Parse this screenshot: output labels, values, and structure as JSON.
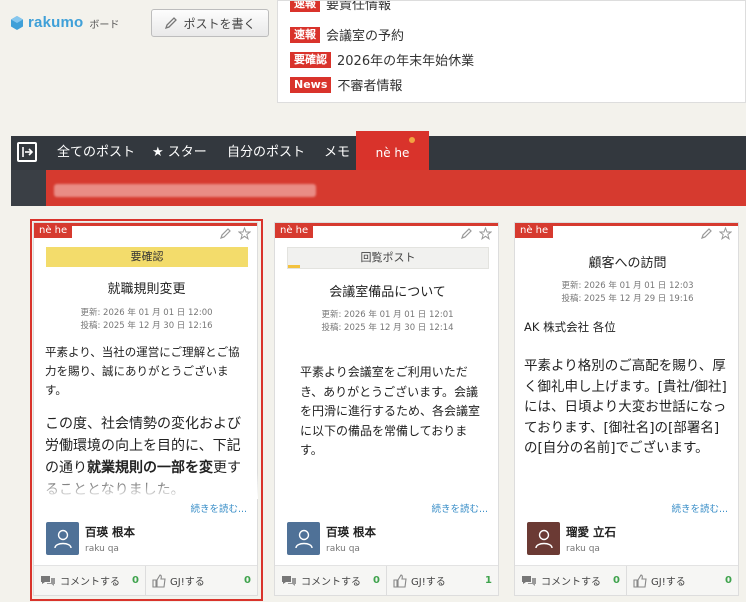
{
  "app": {
    "logo_text": "rakumo",
    "logo_sub": "ボード",
    "write_button": "ポストを書く"
  },
  "news": [
    {
      "badge": "速報",
      "text": "要責任情報"
    },
    {
      "badge": "速報",
      "text": "会議室の予約"
    },
    {
      "badge": "要確認",
      "text": "2026年の年末年始休業"
    },
    {
      "badge": "News",
      "text": "不審者情報"
    }
  ],
  "nav": {
    "items": [
      "全てのポスト",
      "★ スター",
      "自分のポスト",
      "メモ"
    ],
    "active": "nè he"
  },
  "cards": [
    {
      "tag": "nè he",
      "status": "要確認",
      "title": "就職規則変更",
      "updated": "更新: 2026 年 01 月 01 日 12:00",
      "posted": "投稿: 2025 年 12 月 30 日 12:16",
      "body_small": "平素より、当社の運営にご理解とご協力を賜り、誠にありがとうございます。",
      "body_large_1": "この度、社会情勢の変化および労働環境の向上を目的に、下記の通り",
      "body_large_bold": "就業規則の一部を変",
      "body_large_2": "更することとなりました。",
      "read_more": "続きを読む...",
      "author": "百瑛 根本",
      "author_sub": "raku qa",
      "comment_label": "コメントする",
      "comment_count": "0",
      "like_label": "GJ!する",
      "like_count": "0"
    },
    {
      "tag": "nè he",
      "status": "回覧ポスト",
      "title": "会議室備品について",
      "updated": "更新: 2026 年 01 月 01 日 12:01",
      "posted": "投稿: 2025 年 12 月 30 日 12:14",
      "body": "平素より会議室をご利用いただき、ありがとうございます。会議を円滑に進行するため、各会議室に以下の備品を常備しております。",
      "read_more": "続きを読む...",
      "author": "百瑛 根本",
      "author_sub": "raku qa",
      "comment_label": "コメントする",
      "comment_count": "0",
      "like_label": "GJ!する",
      "like_count": "1"
    },
    {
      "tag": "nè he",
      "title": "顧客への訪問",
      "updated": "更新: 2026 年 01 月 01 日 12:03",
      "posted": "投稿: 2025 年 12 月 29 日 19:16",
      "addressee": "AK 株式会社 各位",
      "body": "平素より格別のご高配を賜り、厚く御礼申し上げます。[貴社/御社]には、日頃より大変お世話になっております、[御社名]の[部署名]の[自分の名前]でございます。",
      "read_more": "続きを読む...",
      "author": "瑠愛 立石",
      "author_sub": "raku qa",
      "comment_label": "コメントする",
      "comment_count": "0",
      "like_label": "GJ!する",
      "like_count": "0"
    }
  ],
  "colors": {
    "accent": "#d63a2f",
    "brand": "#3fa0d8",
    "nav_bg": "#33383e",
    "status_yellow": "#f3dc6b",
    "count_green": "#3fa34d"
  },
  "icons": [
    "board-logo-icon",
    "pencil-icon",
    "sidebar-toggle-icon",
    "edit-icon",
    "star-icon",
    "user-icon",
    "comment-icon",
    "thumbs-up-icon"
  ]
}
